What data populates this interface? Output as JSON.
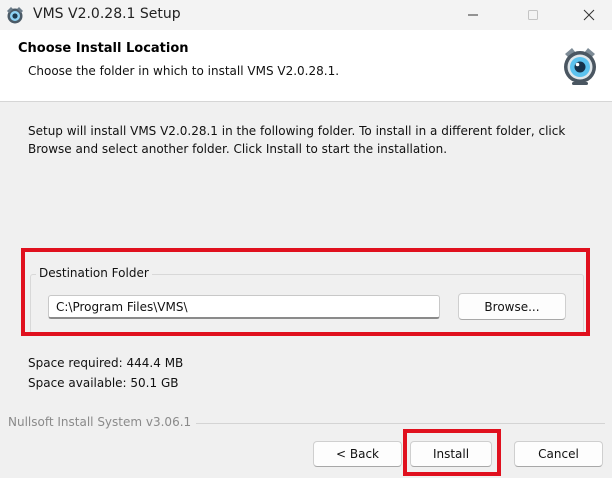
{
  "window": {
    "title": "VMS V2.0.28.1 Setup",
    "icon": "vms-camera-icon",
    "controls": {
      "minimize": "minimize-icon",
      "maximize": "maximize-icon",
      "close": "close-icon"
    }
  },
  "header": {
    "title": "Choose Install Location",
    "subtitle": "Choose the folder in which to install VMS V2.0.28.1.",
    "logo": "vms-camera-icon"
  },
  "body": {
    "intro": "Setup will install VMS V2.0.28.1 in the following folder. To install in a different folder, click Browse and select another folder. Click Install to start the installation.",
    "destination": {
      "group_label": "Destination Folder",
      "path": "C:\\Program Files\\VMS\\",
      "browse_label": "Browse..."
    },
    "space_required": "Space required: 444.4 MB",
    "space_available": "Space available: 50.1 GB"
  },
  "footer": {
    "branding": "Nullsoft Install System v3.06.1",
    "back_label": "< Back",
    "install_label": "Install",
    "cancel_label": "Cancel"
  },
  "colors": {
    "highlight": "#e0101e",
    "dialog_bg": "#f0f0f0",
    "header_bg": "#ffffff"
  }
}
